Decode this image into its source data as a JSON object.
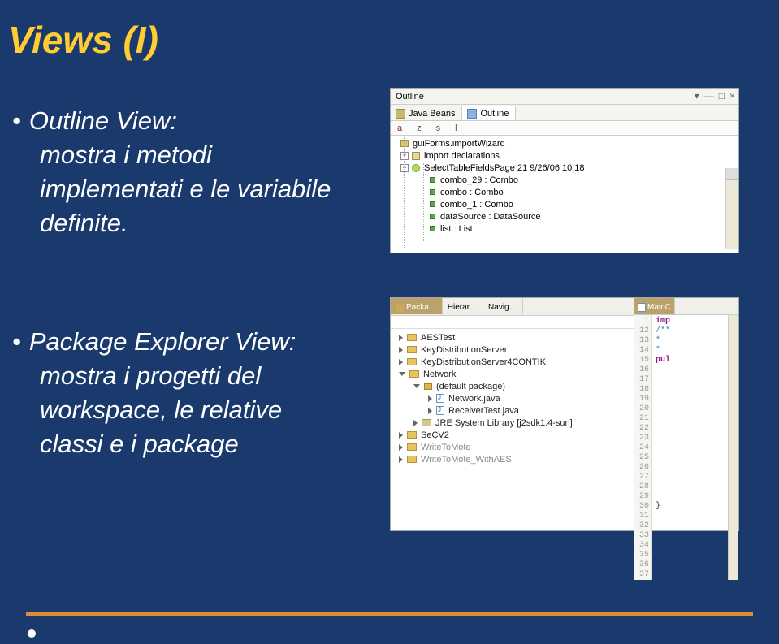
{
  "slide": {
    "title": "Views (I)",
    "bullet1_line1": "Outline View:",
    "bullet1_line2": "mostra i metodi",
    "bullet1_line3": "implementati e le variabile",
    "bullet1_line4": "definite.",
    "bullet2_line1": "Package Explorer View:",
    "bullet2_line2": "mostra i progetti del",
    "bullet2_line3": "workspace, le relative",
    "bullet2_line4": "classi e i package"
  },
  "outline_panel": {
    "title": "Outline",
    "tab1": "Java Beans",
    "tab2": "Outline",
    "sort_a": "a",
    "sort_z": "z",
    "sort_s": "s",
    "sort_l": "l",
    "tree": {
      "n0": "guiForms.importWizard",
      "n1": "import declarations",
      "n2": "SelectTableFieldsPage 21  9/26/06 10:18",
      "n3": "combo_29 : Combo",
      "n4": "combo : Combo",
      "n5": "combo_1 : Combo",
      "n6": "dataSource : DataSource",
      "n7": "list : List"
    }
  },
  "pkg_panel": {
    "tabs": {
      "t0": "Packa…",
      "t1": "Hierar…",
      "t2": "Navig…"
    },
    "tree": {
      "p0": "AESTest",
      "p1": "KeyDistributionServer",
      "p2": "KeyDistributionServer4CONTIKI",
      "p3": "Network",
      "p4": "(default package)",
      "p5": "Network.java",
      "p6": "ReceiverTest.java",
      "p7": "JRE System Library [j2sdk1.4-sun]",
      "p8": "SeCV2",
      "p9": "WriteToMote",
      "p10": "WriteToMote_WithAES"
    },
    "editor": {
      "tab": "MainC",
      "lines": [
        "1",
        "12",
        "13",
        "14",
        "15",
        "16",
        "17",
        "18",
        "19",
        "20",
        "21",
        "22",
        "23",
        "24",
        "25",
        "26",
        "27",
        "28",
        "29",
        "30",
        "31",
        "32",
        "33",
        "34",
        "35",
        "36",
        "37"
      ],
      "c1": "imp",
      "c2": "/**",
      "c3": " *",
      "c4": " *",
      "c5": "pul",
      "c6": "}"
    }
  }
}
